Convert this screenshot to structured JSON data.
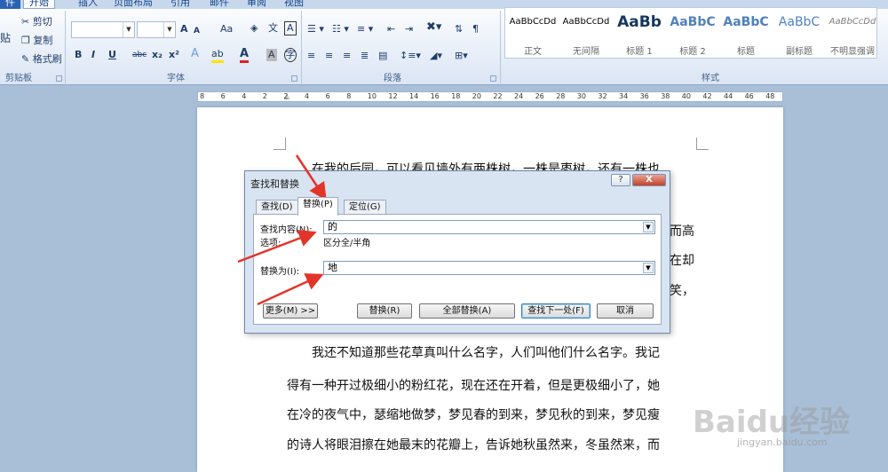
{
  "tabs": [
    "件",
    "开始",
    "插入",
    "页面布局",
    "引用",
    "邮件",
    "审阅",
    "视图"
  ],
  "clipboard": {
    "paste": "贴",
    "cut": "剪切",
    "copy": "复制",
    "format_painter": "格式刷",
    "group": "剪贴板"
  },
  "font": {
    "group": "字体",
    "grow": "A",
    "shrink": "A",
    "case": "Aa",
    "bold": "B",
    "italic": "I",
    "underline": "U",
    "strike": "abc",
    "sub": "x₂",
    "sup": "x²",
    "color_a": "A"
  },
  "paragraph": {
    "group": "段落"
  },
  "styles": {
    "group": "样式",
    "items": [
      {
        "preview": "AaBbCcDd",
        "name": "正文"
      },
      {
        "preview": "AaBbCcDd",
        "name": "无间隔"
      },
      {
        "preview": "AaBb",
        "name": "标题 1"
      },
      {
        "preview": "AaBbC",
        "name": "标题 2"
      },
      {
        "preview": "AaBbC",
        "name": "标题"
      },
      {
        "preview": "AaBbC",
        "name": "副标题"
      },
      {
        "preview": "AaBbCcDd",
        "name": "不明显强调"
      }
    ]
  },
  "ruler": [
    "8",
    "6",
    "4",
    "2",
    "2",
    "4",
    "6",
    "8",
    "10",
    "12",
    "14",
    "16",
    "18",
    "20",
    "22",
    "24",
    "26",
    "28",
    "30",
    "32",
    "34",
    "36",
    "38",
    "40",
    "42",
    "44",
    "46",
    "48"
  ],
  "document": {
    "lines": [
      "在我的后园，可以看见墙外有两株树，一株是枣树，还有一株也",
      "而高",
      "在却",
      "笑，",
      "我还不知道那些花草真叫什么名字，人们叫他们什么名字。我记",
      "得有一种开过极细小的粉红花，现在还在开着，但是更极细小了，她",
      "在冷的夜气中，瑟缩地做梦，梦见春的到来，梦见秋的到来，梦见瘦",
      "的诗人将眼泪擦在她最末的花瓣上，告诉她秋虽然来，冬虽然来，而"
    ]
  },
  "dialog": {
    "title": "查找和替换",
    "help": "?",
    "close": "X",
    "tabs": [
      "查找(D)",
      "替换(P)",
      "定位(G)"
    ],
    "find_label": "查找内容(N):",
    "find_value": "的",
    "options_label": "选项:",
    "options_value": "区分全/半角",
    "replace_label": "替换为(I):",
    "replace_value": "地",
    "buttons": {
      "more": "更多(M) >>",
      "replace": "替换(R)",
      "replace_all": "全部替换(A)",
      "find_next": "查找下一处(F)",
      "cancel": "取消"
    }
  },
  "watermark": {
    "text": "Baidu经验",
    "url": "jingyan.baidu.com"
  },
  "colors": {
    "ribbon": "#e4ecf7",
    "workspace": "#a9bfd8",
    "arrow": "#e3342a"
  }
}
